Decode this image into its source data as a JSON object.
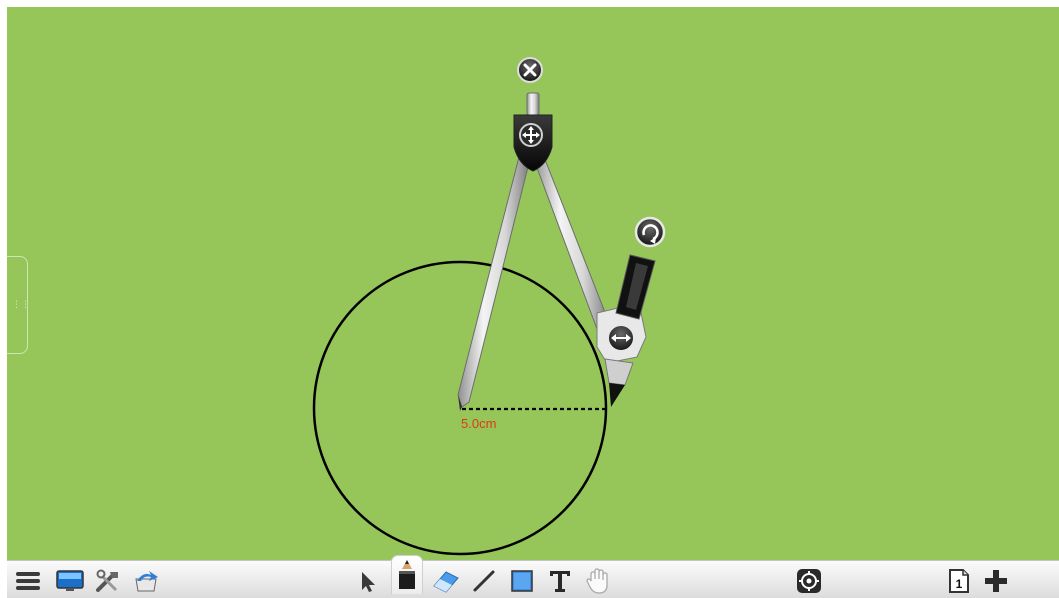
{
  "colors": {
    "board_background": "#96c65a",
    "circle_stroke": "#000000",
    "radius_label": "#e03a0e",
    "toolbar_background": "#f0f0f0",
    "toolbar_active_tool": "pencil"
  },
  "compass": {
    "radius_label": "5.0cm",
    "buttons": [
      "close-icon",
      "move-icon",
      "rotate-icon",
      "resize-icon"
    ]
  },
  "toolbar": {
    "left": [
      "menu-icon",
      "screen-icon",
      "tools-icon",
      "resources-icon"
    ],
    "center": [
      "select-icon",
      "pencil-icon",
      "eraser-icon",
      "line-icon",
      "shape-icon",
      "text-icon",
      "hand-icon"
    ],
    "right": [
      "locate-icon",
      "page-icon",
      "add-page-icon"
    ],
    "page_number": "1"
  }
}
